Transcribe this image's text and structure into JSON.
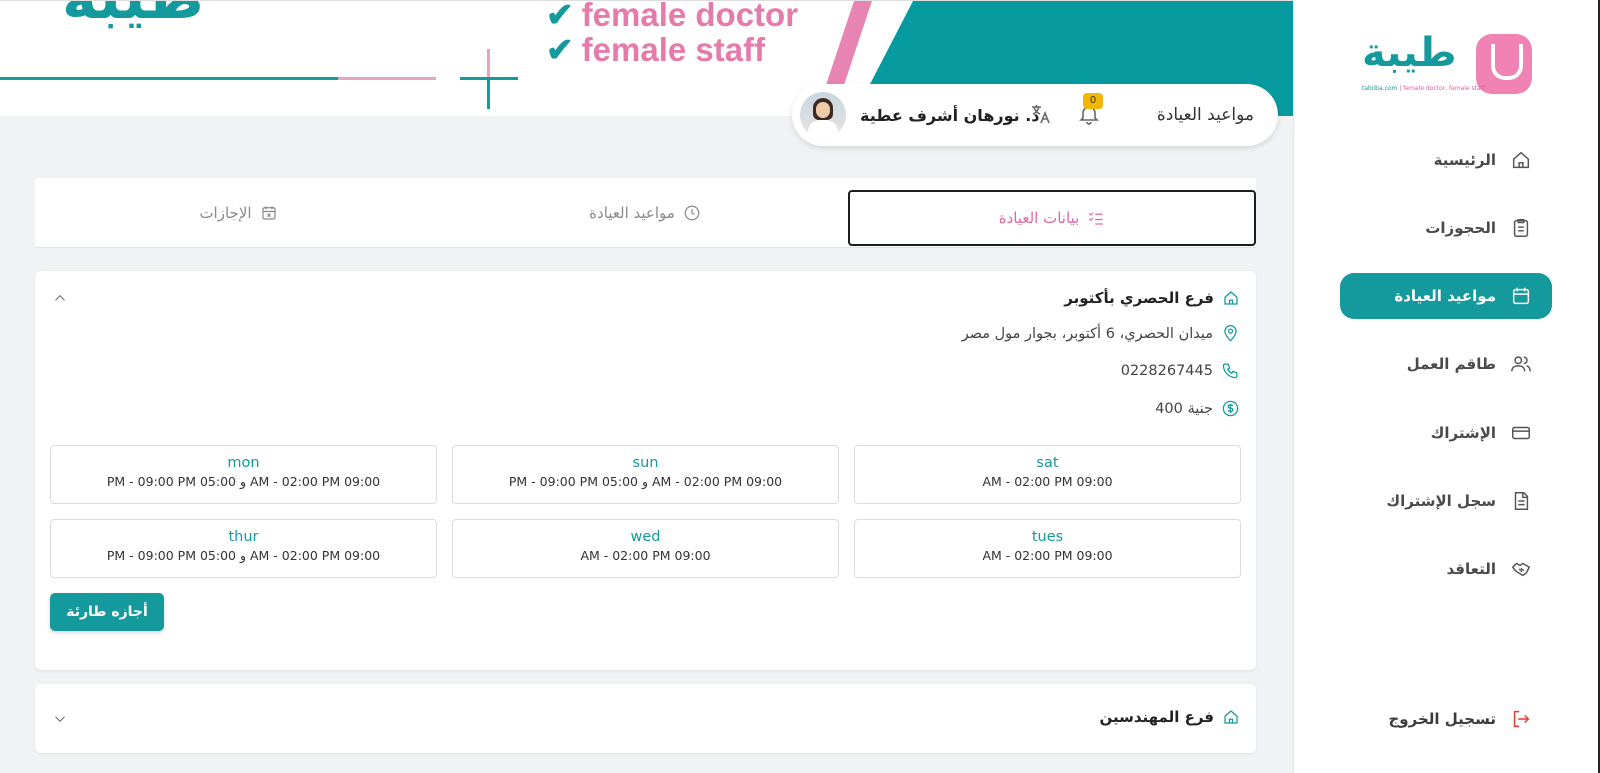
{
  "logo": {
    "word": "طيبة",
    "tagline_site": "tabiiba.com",
    "tagline_sep": "|",
    "tagline_text": "female doctor, female staff"
  },
  "banner": {
    "logo_text": "طيبة",
    "line1": "female doctor",
    "line2": "female staff"
  },
  "sidebar": {
    "items": [
      {
        "label": "الرئيسية",
        "icon": "home-icon"
      },
      {
        "label": "الحجوزات",
        "icon": "clipboard-icon"
      },
      {
        "label": "مواعيد العيادة",
        "icon": "calendar-icon",
        "active": true
      },
      {
        "label": "طاقم العمل",
        "icon": "users-icon"
      },
      {
        "label": "الإشتراك",
        "icon": "credit-card-icon"
      },
      {
        "label": "سجل الإشتراك",
        "icon": "document-icon"
      },
      {
        "label": "التعاقد",
        "icon": "handshake-icon"
      }
    ],
    "logout_label": "تسجيل الخروج"
  },
  "header": {
    "title": "مواعيد العيادة",
    "notification_count": "0",
    "doctor_name": "د. نورهان أشرف عطية"
  },
  "tabs": [
    {
      "label": "بيانات العيادة",
      "active": true
    },
    {
      "label": "مواعيد العيادة"
    },
    {
      "label": "الإجازات"
    }
  ],
  "branches": [
    {
      "name": "فرع الحصري بأكتوبر",
      "address": "ميدان الحصري، 6 أكتوبر، بجوار مول مصر",
      "phone": "0228267445",
      "price": "400 جنية",
      "expanded": true,
      "days": [
        {
          "day": "sat",
          "time": "AM - 02:00 PM 09:00"
        },
        {
          "day": "sun",
          "time": "PM - 09:00 PM 05:00 و AM - 02:00 PM 09:00"
        },
        {
          "day": "mon",
          "time": "PM - 09:00 PM 05:00 و AM - 02:00 PM 09:00"
        },
        {
          "day": "tues",
          "time": "AM - 02:00 PM 09:00"
        },
        {
          "day": "wed",
          "time": "AM - 02:00 PM 09:00"
        },
        {
          "day": "thur",
          "time": "PM - 09:00 PM 05:00 و AM - 02:00 PM 09:00"
        }
      ],
      "emergency_button": "أجازه طارئة"
    },
    {
      "name": "فرع المهندسين",
      "expanded": false
    }
  ],
  "colors": {
    "primary": "#14999d",
    "accent_pink": "#e0699f",
    "badge": "#f2b705",
    "logout": "#e53935"
  }
}
